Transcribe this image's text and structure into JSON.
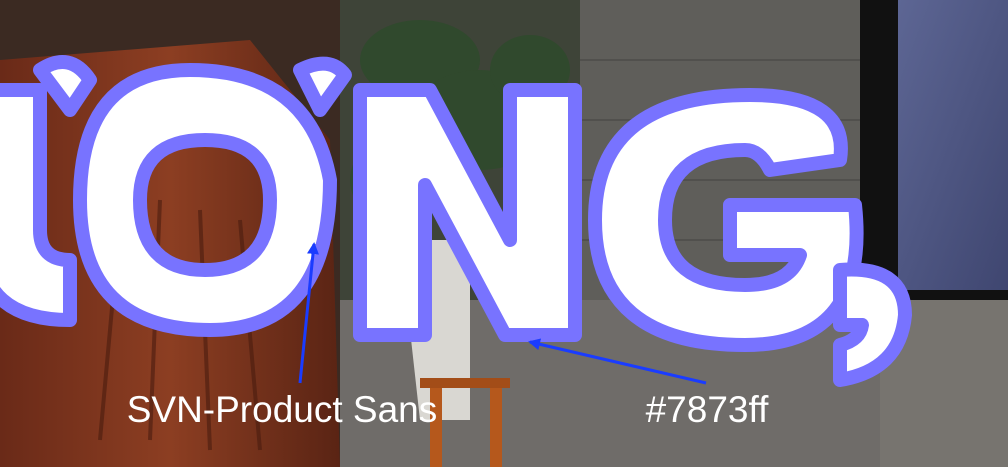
{
  "headline": {
    "visible_text": "ƯƠNG,",
    "fill_color": "#ffffff",
    "stroke_color": "#7873ff"
  },
  "annotations": [
    {
      "label": "SVN-Product Sans",
      "points_to": "headline letter O"
    },
    {
      "label": "#7873ff",
      "points_to": "headline outline stroke"
    }
  ],
  "annotation_color": "#1a3cff",
  "annotation_text_color": "#ffffff"
}
